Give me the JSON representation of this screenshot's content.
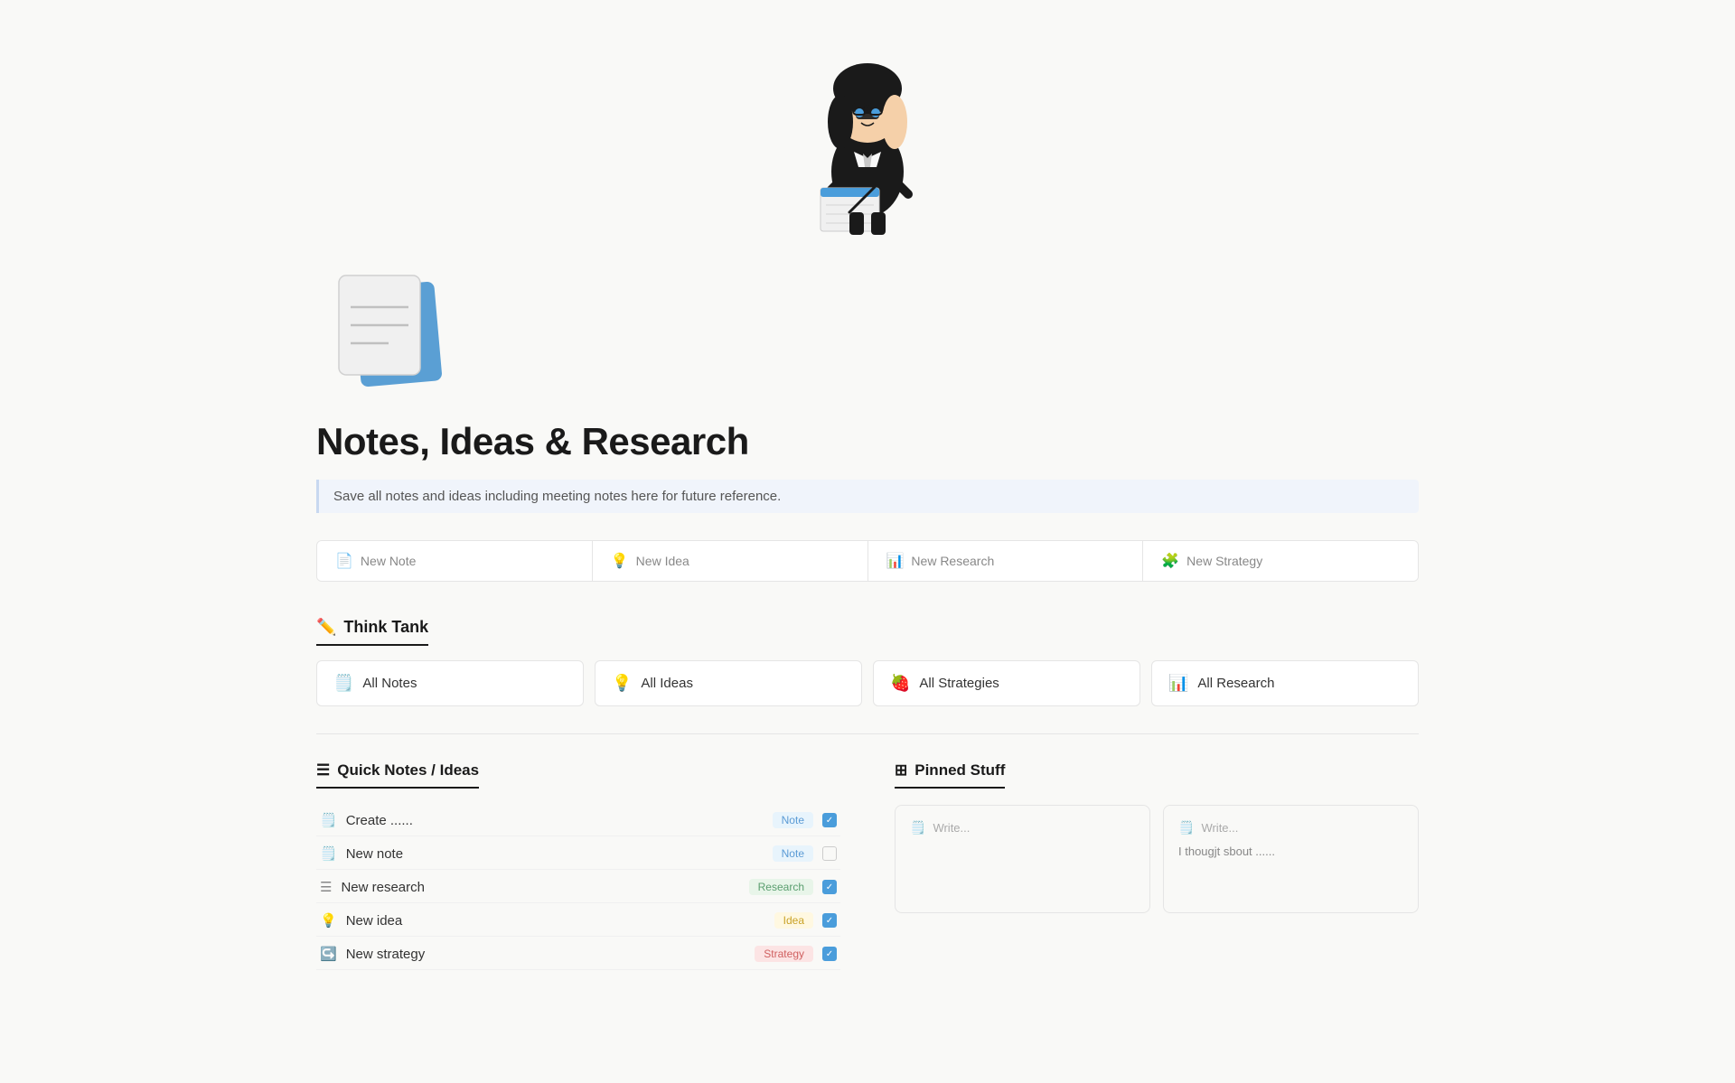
{
  "hero": {
    "alt": "person writing notes illustration"
  },
  "page": {
    "icon_alt": "notes notebook icon",
    "title": "Notes, Ideas & Research",
    "subtitle": "Save all notes and ideas including meeting notes here for future reference."
  },
  "quick_actions": [
    {
      "id": "new-note",
      "icon": "📄",
      "label": "New Note"
    },
    {
      "id": "new-idea",
      "icon": "💡",
      "label": "New Idea"
    },
    {
      "id": "new-research",
      "icon": "📊",
      "label": "New Research"
    },
    {
      "id": "new-strategy",
      "icon": "🧩",
      "label": "New Strategy"
    }
  ],
  "think_tank": {
    "heading_icon": "✏️",
    "heading": "Think Tank",
    "views": [
      {
        "id": "all-notes",
        "icon": "🗒️",
        "label": "All Notes"
      },
      {
        "id": "all-ideas",
        "icon": "💡",
        "label": "All Ideas"
      },
      {
        "id": "all-strategies",
        "icon": "🍓",
        "label": "All Strategies"
      },
      {
        "id": "all-research",
        "icon": "📊",
        "label": "All Research"
      }
    ]
  },
  "quick_notes": {
    "heading_icon": "☰",
    "heading": "Quick Notes / Ideas",
    "items": [
      {
        "icon": "🗒️",
        "title": "Create ......",
        "tag": "Note",
        "tag_class": "tag-note",
        "checked": true
      },
      {
        "icon": "🗒️",
        "title": "New note",
        "tag": "Note",
        "tag_class": "tag-note",
        "checked": false
      },
      {
        "icon": "☰",
        "title": "New research",
        "tag": "Research",
        "tag_class": "tag-research",
        "checked": true
      },
      {
        "icon": "💡",
        "title": "New idea",
        "tag": "Idea",
        "tag_class": "tag-idea",
        "checked": true
      },
      {
        "icon": "↪️",
        "title": "New strategy",
        "tag": "Strategy",
        "tag_class": "tag-strategy",
        "checked": true
      }
    ]
  },
  "pinned": {
    "heading_icon": "⊞",
    "heading": "Pinned Stuff",
    "cards": [
      {
        "id": "pinned-1",
        "icon": "🗒️",
        "label": "Write...",
        "body": ""
      },
      {
        "id": "pinned-2",
        "icon": "🗒️",
        "label": "Write...",
        "body": "I thougjt sbout ......"
      }
    ]
  }
}
